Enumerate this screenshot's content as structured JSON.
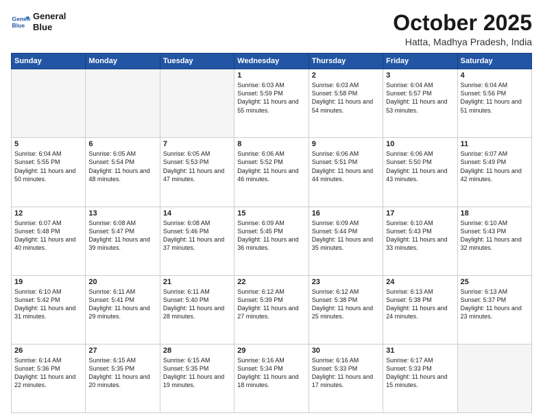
{
  "header": {
    "logo_line1": "General",
    "logo_line2": "Blue",
    "month": "October 2025",
    "location": "Hatta, Madhya Pradesh, India"
  },
  "weekdays": [
    "Sunday",
    "Monday",
    "Tuesday",
    "Wednesday",
    "Thursday",
    "Friday",
    "Saturday"
  ],
  "weeks": [
    [
      {
        "day": "",
        "empty": true
      },
      {
        "day": "",
        "empty": true
      },
      {
        "day": "",
        "empty": true
      },
      {
        "day": "1",
        "sunrise": "6:03 AM",
        "sunset": "5:59 PM",
        "daylight": "11 hours and 55 minutes."
      },
      {
        "day": "2",
        "sunrise": "6:03 AM",
        "sunset": "5:58 PM",
        "daylight": "11 hours and 54 minutes."
      },
      {
        "day": "3",
        "sunrise": "6:04 AM",
        "sunset": "5:57 PM",
        "daylight": "11 hours and 53 minutes."
      },
      {
        "day": "4",
        "sunrise": "6:04 AM",
        "sunset": "5:56 PM",
        "daylight": "11 hours and 51 minutes."
      }
    ],
    [
      {
        "day": "5",
        "sunrise": "6:04 AM",
        "sunset": "5:55 PM",
        "daylight": "11 hours and 50 minutes."
      },
      {
        "day": "6",
        "sunrise": "6:05 AM",
        "sunset": "5:54 PM",
        "daylight": "11 hours and 48 minutes."
      },
      {
        "day": "7",
        "sunrise": "6:05 AM",
        "sunset": "5:53 PM",
        "daylight": "11 hours and 47 minutes."
      },
      {
        "day": "8",
        "sunrise": "6:06 AM",
        "sunset": "5:52 PM",
        "daylight": "11 hours and 46 minutes."
      },
      {
        "day": "9",
        "sunrise": "6:06 AM",
        "sunset": "5:51 PM",
        "daylight": "11 hours and 44 minutes."
      },
      {
        "day": "10",
        "sunrise": "6:06 AM",
        "sunset": "5:50 PM",
        "daylight": "11 hours and 43 minutes."
      },
      {
        "day": "11",
        "sunrise": "6:07 AM",
        "sunset": "5:49 PM",
        "daylight": "11 hours and 42 minutes."
      }
    ],
    [
      {
        "day": "12",
        "sunrise": "6:07 AM",
        "sunset": "5:48 PM",
        "daylight": "11 hours and 40 minutes."
      },
      {
        "day": "13",
        "sunrise": "6:08 AM",
        "sunset": "5:47 PM",
        "daylight": "11 hours and 39 minutes."
      },
      {
        "day": "14",
        "sunrise": "6:08 AM",
        "sunset": "5:46 PM",
        "daylight": "11 hours and 37 minutes."
      },
      {
        "day": "15",
        "sunrise": "6:09 AM",
        "sunset": "5:45 PM",
        "daylight": "11 hours and 36 minutes."
      },
      {
        "day": "16",
        "sunrise": "6:09 AM",
        "sunset": "5:44 PM",
        "daylight": "11 hours and 35 minutes."
      },
      {
        "day": "17",
        "sunrise": "6:10 AM",
        "sunset": "5:43 PM",
        "daylight": "11 hours and 33 minutes."
      },
      {
        "day": "18",
        "sunrise": "6:10 AM",
        "sunset": "5:43 PM",
        "daylight": "11 hours and 32 minutes."
      }
    ],
    [
      {
        "day": "19",
        "sunrise": "6:10 AM",
        "sunset": "5:42 PM",
        "daylight": "11 hours and 31 minutes."
      },
      {
        "day": "20",
        "sunrise": "6:11 AM",
        "sunset": "5:41 PM",
        "daylight": "11 hours and 29 minutes."
      },
      {
        "day": "21",
        "sunrise": "6:11 AM",
        "sunset": "5:40 PM",
        "daylight": "11 hours and 28 minutes."
      },
      {
        "day": "22",
        "sunrise": "6:12 AM",
        "sunset": "5:39 PM",
        "daylight": "11 hours and 27 minutes."
      },
      {
        "day": "23",
        "sunrise": "6:12 AM",
        "sunset": "5:38 PM",
        "daylight": "11 hours and 25 minutes."
      },
      {
        "day": "24",
        "sunrise": "6:13 AM",
        "sunset": "5:38 PM",
        "daylight": "11 hours and 24 minutes."
      },
      {
        "day": "25",
        "sunrise": "6:13 AM",
        "sunset": "5:37 PM",
        "daylight": "11 hours and 23 minutes."
      }
    ],
    [
      {
        "day": "26",
        "sunrise": "6:14 AM",
        "sunset": "5:36 PM",
        "daylight": "11 hours and 22 minutes."
      },
      {
        "day": "27",
        "sunrise": "6:15 AM",
        "sunset": "5:35 PM",
        "daylight": "11 hours and 20 minutes."
      },
      {
        "day": "28",
        "sunrise": "6:15 AM",
        "sunset": "5:35 PM",
        "daylight": "11 hours and 19 minutes."
      },
      {
        "day": "29",
        "sunrise": "6:16 AM",
        "sunset": "5:34 PM",
        "daylight": "11 hours and 18 minutes."
      },
      {
        "day": "30",
        "sunrise": "6:16 AM",
        "sunset": "5:33 PM",
        "daylight": "11 hours and 17 minutes."
      },
      {
        "day": "31",
        "sunrise": "6:17 AM",
        "sunset": "5:33 PM",
        "daylight": "11 hours and 15 minutes."
      },
      {
        "day": "",
        "empty": true
      }
    ]
  ]
}
